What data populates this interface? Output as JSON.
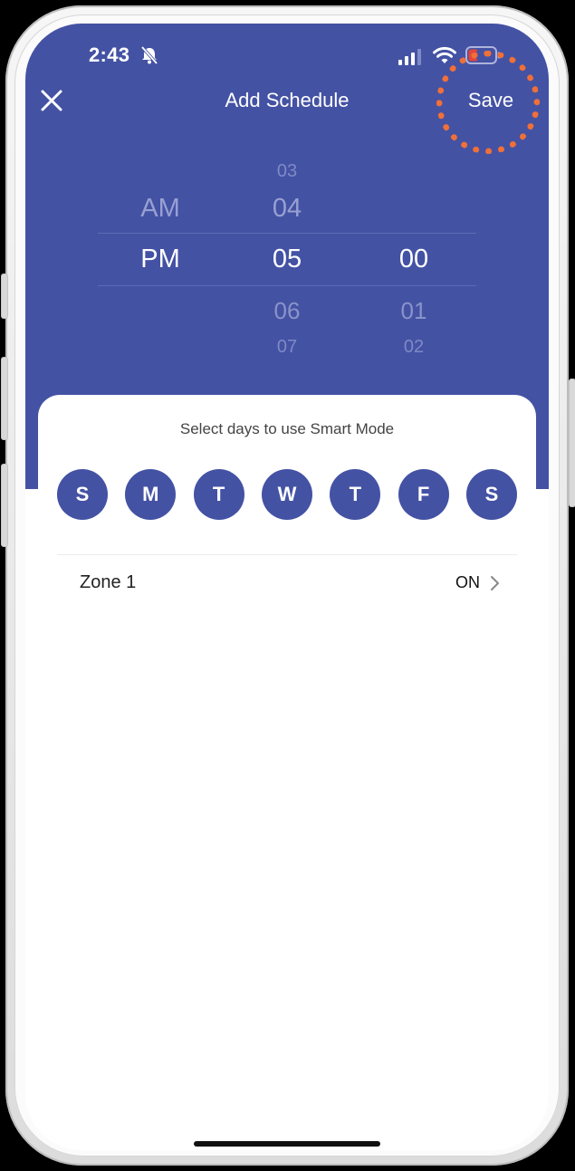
{
  "status_bar": {
    "time": "2:43",
    "battery": "29"
  },
  "nav": {
    "title": "Add Schedule",
    "save_label": "Save"
  },
  "time_picker": {
    "period": {
      "above": "AM",
      "selected": "PM"
    },
    "hour": {
      "above2": "03",
      "above1": "04",
      "selected": "05",
      "below1": "06",
      "below2": "07"
    },
    "minute": {
      "selected": "00",
      "below1": "01",
      "below2": "02"
    }
  },
  "days_card": {
    "caption": "Select days to use Smart Mode",
    "days": [
      "S",
      "M",
      "T",
      "W",
      "T",
      "F",
      "S"
    ]
  },
  "zone": {
    "label": "Zone 1",
    "status": "ON"
  },
  "colors": {
    "header": "#4452a4",
    "highlight": "#f07038",
    "card": "#ffffff"
  },
  "icons": [
    "bell-slash-icon",
    "signal-icon",
    "wifi-icon",
    "battery-icon",
    "close-icon",
    "chevron-right-icon"
  ]
}
